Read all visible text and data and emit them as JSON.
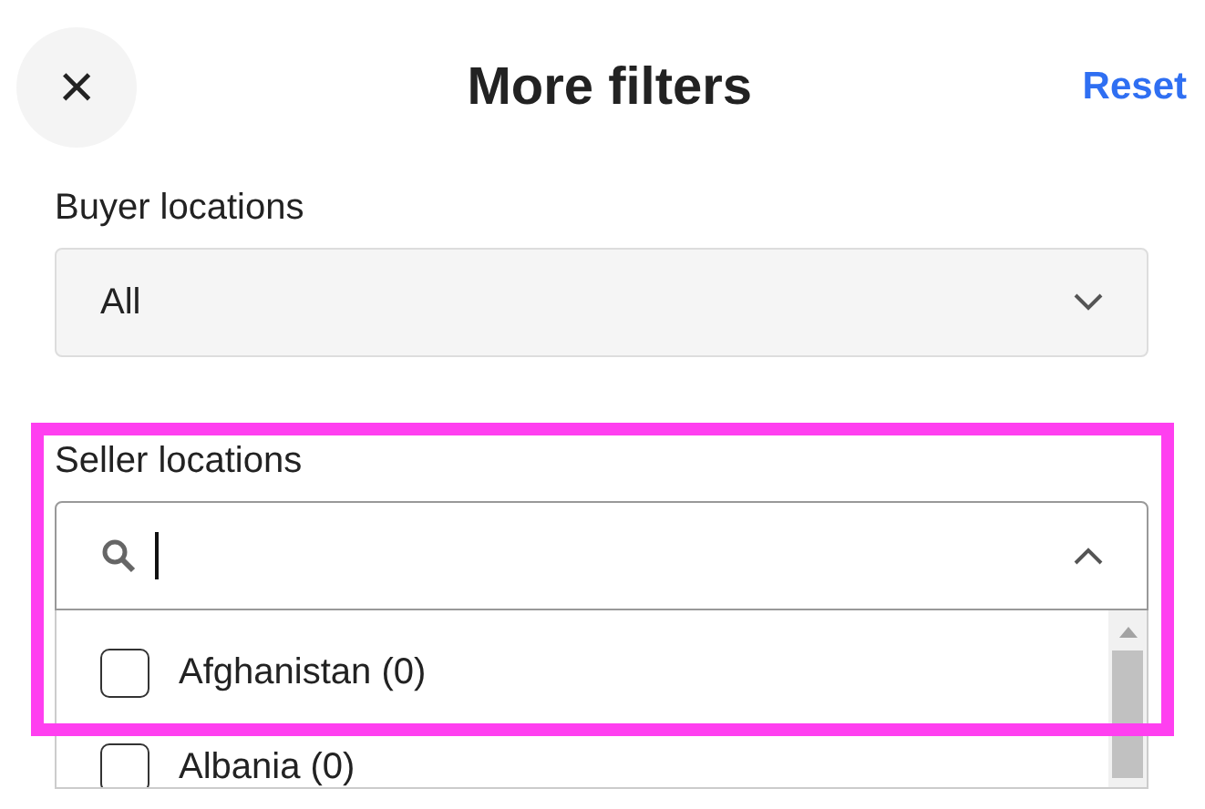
{
  "header": {
    "close": "×",
    "title": "More filters",
    "reset": "Reset"
  },
  "buyer_locations": {
    "label": "Buyer locations",
    "value": "All",
    "expanded": false
  },
  "seller_locations": {
    "label": "Seller locations",
    "highlighted": true,
    "expanded": true,
    "focused": true,
    "options": [
      {
        "label": "Afghanistan (0)",
        "checked": false
      },
      {
        "label": "Albania (0)",
        "checked": false
      }
    ]
  }
}
